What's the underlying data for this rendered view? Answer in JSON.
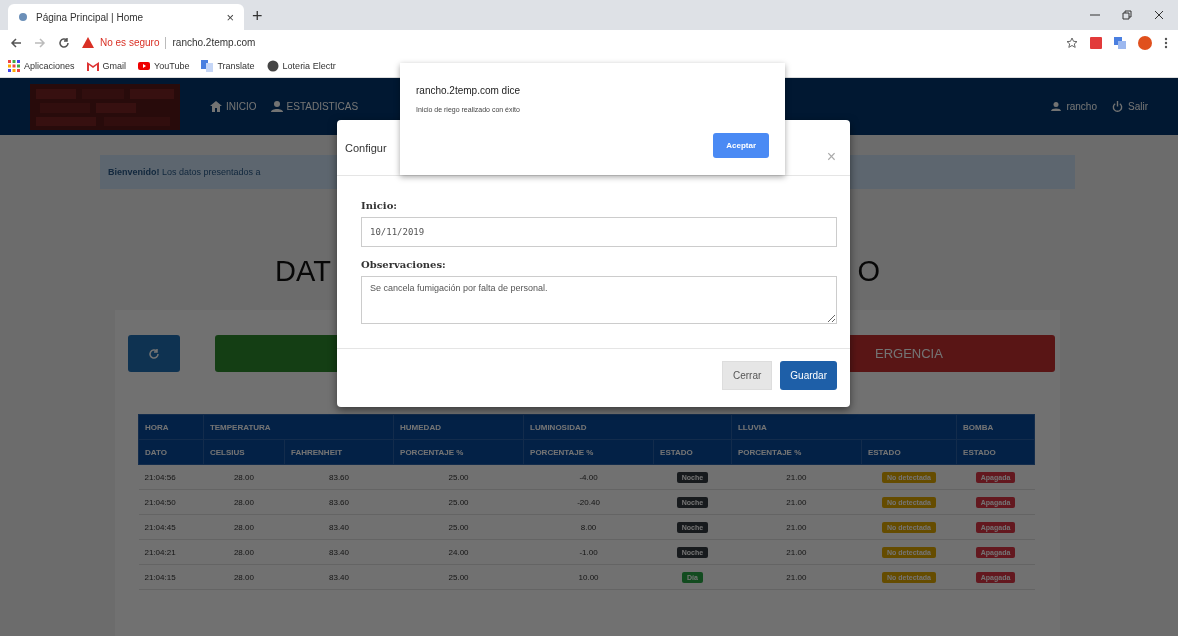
{
  "browser": {
    "tab_title": "Página Principal | Home",
    "tab_close": "×",
    "new_tab": "+",
    "security": "No es seguro",
    "url": "rancho.2temp.com",
    "bookmarks": [
      {
        "label": "Aplicaciones",
        "kind": "apps"
      },
      {
        "label": "Gmail",
        "kind": "mail"
      },
      {
        "label": "YouTube",
        "kind": "video"
      },
      {
        "label": "Translate",
        "kind": "translate"
      },
      {
        "label": "Loteria Electr",
        "kind": "globe"
      }
    ]
  },
  "navbar": {
    "items": [
      {
        "label": "INICIO",
        "kind": "home"
      },
      {
        "label": "ESTADISTICAS",
        "kind": "user"
      }
    ],
    "user": "rancho",
    "logout": "Salir"
  },
  "banner": "**Bienvenido!** Los datos presentados a",
  "heading": {
    "left": "DAT",
    "right": "O"
  },
  "actions": {
    "emergency_fragment": "ERGENCIA"
  },
  "table": {
    "groups": [
      {
        "label": "HORA",
        "columns": [
          "DATO"
        ]
      },
      {
        "label": "TEMPERATURA",
        "columns": [
          "CELSIUS",
          "FAHRENHEIT"
        ]
      },
      {
        "label": "HUMEDAD",
        "columns": [
          "PORCENTAJE %"
        ]
      },
      {
        "label": "LUMINOSIDAD",
        "columns": [
          "PORCENTAJE %",
          "ESTADO"
        ]
      },
      {
        "label": "LLUVIA",
        "columns": [
          "PORCENTAJE %",
          "ESTADO"
        ]
      },
      {
        "label": "BOMBA",
        "columns": [
          "ESTADO"
        ]
      }
    ],
    "rows": [
      {
        "hora": "21:04:56",
        "celsius": "28.00",
        "fahrenheit": "83.60",
        "humedad": "25.00",
        "luminosidad": "-4.00",
        "luz": {
          "label": "Noche",
          "kind": "night"
        },
        "lluvia": "21.00",
        "lluvia_estado": "No detectada",
        "bomba": "Apagada"
      },
      {
        "hora": "21:04:50",
        "celsius": "28.00",
        "fahrenheit": "83.60",
        "humedad": "25.00",
        "luminosidad": "-20.40",
        "luz": {
          "label": "Noche",
          "kind": "night"
        },
        "lluvia": "21.00",
        "lluvia_estado": "No detectada",
        "bomba": "Apagada"
      },
      {
        "hora": "21:04:45",
        "celsius": "28.00",
        "fahrenheit": "83.40",
        "humedad": "25.00",
        "luminosidad": "8.00",
        "luz": {
          "label": "Noche",
          "kind": "night"
        },
        "lluvia": "21.00",
        "lluvia_estado": "No detectada",
        "bomba": "Apagada"
      },
      {
        "hora": "21:04:21",
        "celsius": "28.00",
        "fahrenheit": "83.40",
        "humedad": "24.00",
        "luminosidad": "-1.00",
        "luz": {
          "label": "Noche",
          "kind": "night"
        },
        "lluvia": "21.00",
        "lluvia_estado": "No detectada",
        "bomba": "Apagada"
      },
      {
        "hora": "21:04:15",
        "celsius": "28.00",
        "fahrenheit": "83.40",
        "humedad": "25.00",
        "luminosidad": "10.00",
        "luz": {
          "label": "Día",
          "kind": "day"
        },
        "lluvia": "21.00",
        "lluvia_estado": "No detectada",
        "bomba": "Apagada"
      }
    ]
  },
  "modal": {
    "title": "Configur",
    "close": "×",
    "fields": [
      {
        "label": "Inicio:",
        "value": "10/11/2019",
        "kind": "input"
      },
      {
        "label": "Observaciones:",
        "value": "Se cancela fumigación por falta de personal.",
        "kind": "textarea"
      }
    ],
    "buttons": [
      {
        "label": "Cerrar",
        "kind": "secondary"
      },
      {
        "label": "Guardar",
        "kind": "primary"
      }
    ]
  },
  "alert": {
    "title": "rancho.2temp.com dice",
    "message": "Inicio de riego realizado con éxito",
    "button": "Aceptar"
  }
}
